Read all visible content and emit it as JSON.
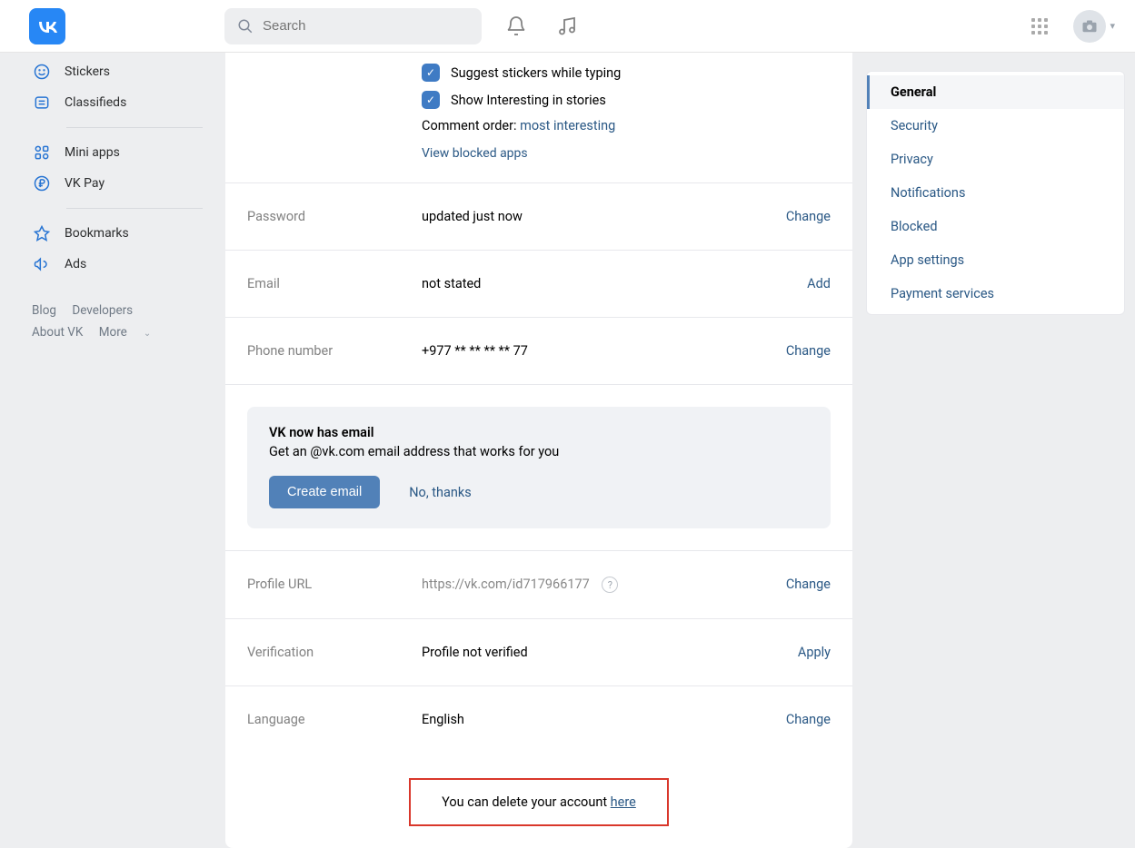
{
  "header": {
    "search_placeholder": "Search"
  },
  "sidebar": {
    "items": [
      {
        "label": "Stickers"
      },
      {
        "label": "Classifieds"
      },
      {
        "label": "Mini apps"
      },
      {
        "label": "VK Pay"
      },
      {
        "label": "Bookmarks"
      },
      {
        "label": "Ads"
      }
    ],
    "footer": {
      "blog": "Blog",
      "developers": "Developers",
      "about": "About VK",
      "more": "More"
    }
  },
  "settings": {
    "suggest_stickers": "Suggest stickers while typing",
    "show_interesting": "Show Interesting in stories",
    "comment_order_label": "Comment order:",
    "comment_order_value": "most interesting",
    "view_blocked": "View blocked apps",
    "password": {
      "label": "Password",
      "value": "updated just now",
      "action": "Change"
    },
    "email": {
      "label": "Email",
      "value": "not stated",
      "action": "Add"
    },
    "phone": {
      "label": "Phone number",
      "value": "+977 ** ** ** ** 77",
      "action": "Change"
    },
    "banner": {
      "title": "VK now has email",
      "sub": "Get an @vk.com email address that works for you",
      "primary": "Create email",
      "secondary": "No, thanks"
    },
    "profile_url": {
      "label": "Profile URL",
      "value": "https://vk.com/id717966177",
      "action": "Change"
    },
    "verification": {
      "label": "Verification",
      "value": "Profile not verified",
      "action": "Apply"
    },
    "language": {
      "label": "Language",
      "value": "English",
      "action": "Change"
    },
    "delete_prefix": "You can delete your account ",
    "delete_here": "here"
  },
  "rightnav": {
    "items": [
      "General",
      "Security",
      "Privacy",
      "Notifications",
      "Blocked",
      "App settings",
      "Payment services"
    ]
  }
}
